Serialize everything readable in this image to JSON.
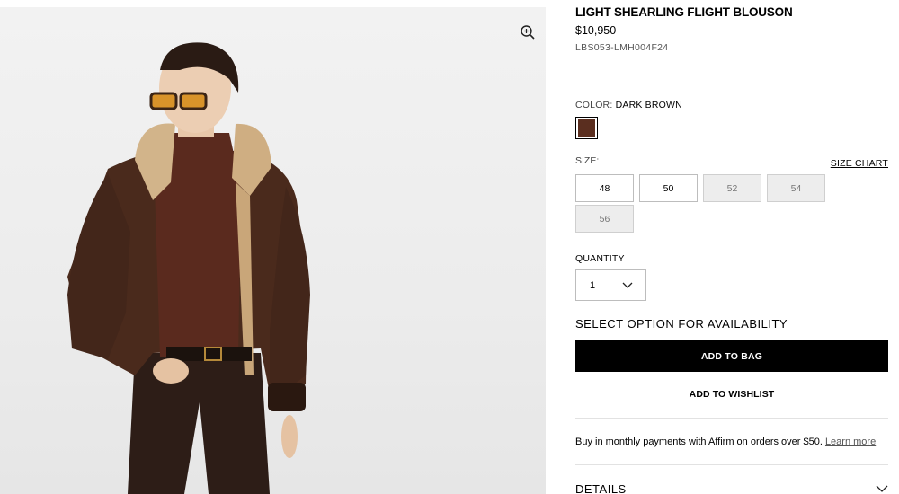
{
  "product": {
    "title": "LIGHT SHEARLING FLIGHT BLOUSON",
    "price": "$10,950",
    "sku": "LBS053-LMH004F24"
  },
  "color": {
    "label": "COLOR:",
    "value": "DARK BROWN",
    "swatch_hex": "#5a2e1f"
  },
  "size": {
    "label": "SIZE:",
    "chart_link": "SIZE CHART",
    "options": [
      {
        "label": "48",
        "available": true
      },
      {
        "label": "50",
        "available": true
      },
      {
        "label": "52",
        "available": false
      },
      {
        "label": "54",
        "available": false
      },
      {
        "label": "56",
        "available": false
      }
    ]
  },
  "quantity": {
    "label": "QUANTITY",
    "value": "1"
  },
  "availability_text": "SELECT OPTION FOR AVAILABILITY",
  "actions": {
    "add_to_bag": "ADD TO BAG",
    "add_to_wishlist": "ADD TO WISHLIST"
  },
  "affirm": {
    "text": "Buy in monthly payments with Affirm on orders over $50.",
    "link": "Learn more"
  },
  "accordion": {
    "details_label": "DETAILS"
  },
  "icons": {
    "zoom": "zoom-in-icon",
    "quantity_chevron": "chevron-down-icon",
    "details_chevron": "chevron-down-icon"
  },
  "colors": {
    "button_bg": "#000000",
    "unavailable_bg": "#ededed",
    "jacket_brown": "#4a2a1c"
  }
}
